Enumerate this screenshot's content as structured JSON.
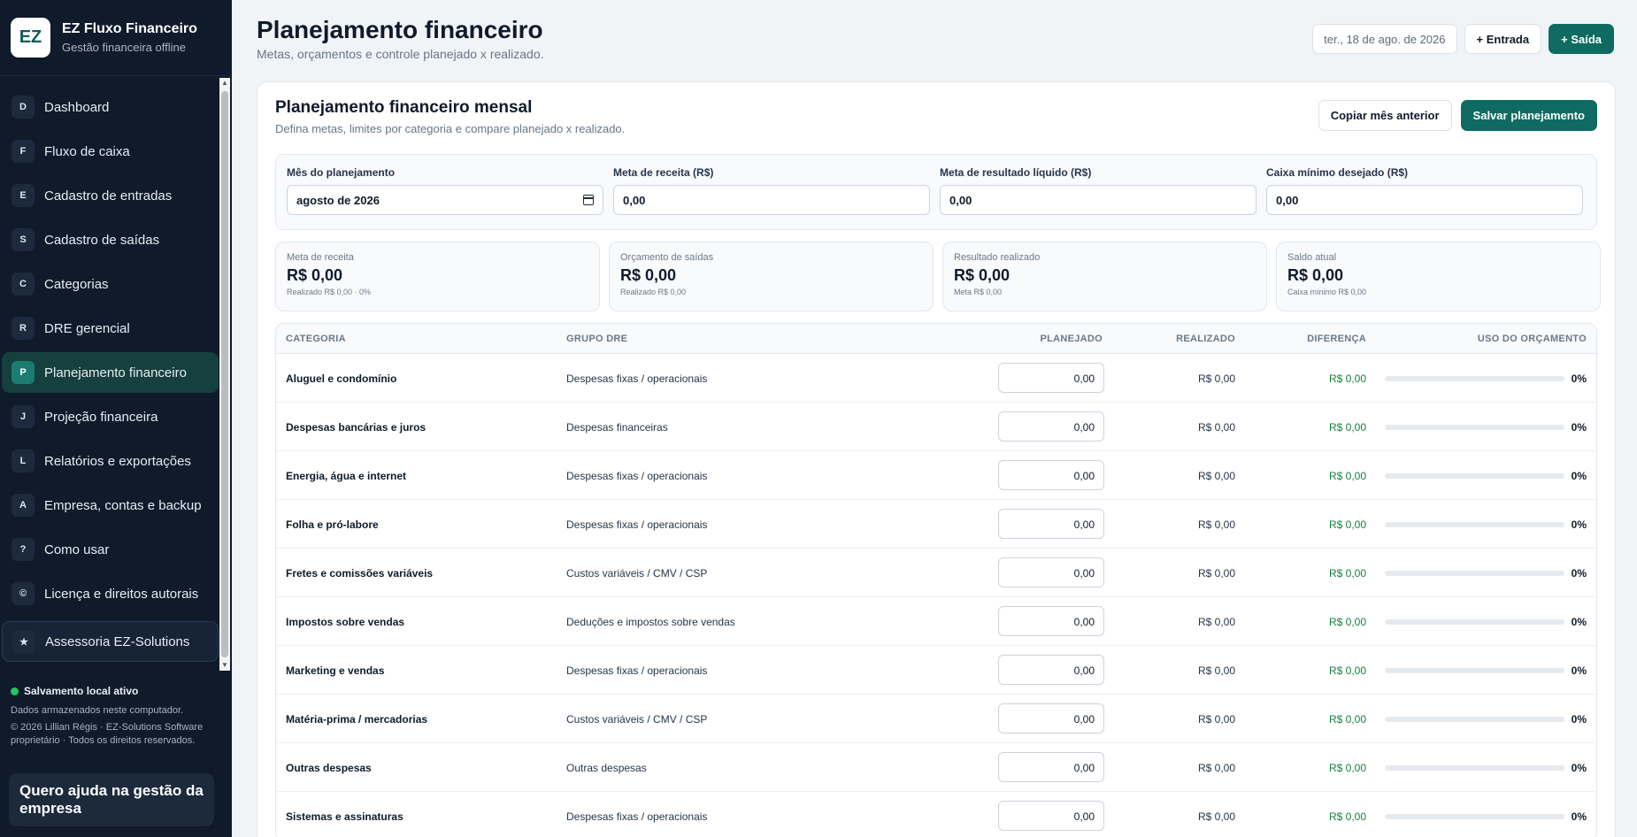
{
  "brand": {
    "logo": "EZ",
    "title": "EZ Fluxo Financeiro",
    "subtitle": "Gestão financeira offline"
  },
  "nav": [
    {
      "badge": "D",
      "label": "Dashboard"
    },
    {
      "badge": "F",
      "label": "Fluxo de caixa"
    },
    {
      "badge": "E",
      "label": "Cadastro de entradas"
    },
    {
      "badge": "S",
      "label": "Cadastro de saídas"
    },
    {
      "badge": "C",
      "label": "Categorias"
    },
    {
      "badge": "R",
      "label": "DRE gerencial"
    },
    {
      "badge": "P",
      "label": "Planejamento financeiro",
      "active": true
    },
    {
      "badge": "J",
      "label": "Projeção financeira"
    },
    {
      "badge": "L",
      "label": "Relatórios e exportações"
    },
    {
      "badge": "A",
      "label": "Empresa, contas e backup"
    },
    {
      "badge": "?",
      "label": "Como usar"
    },
    {
      "badge": "©",
      "label": "Licença e direitos autorais"
    },
    {
      "badge": "★",
      "label": "Assessoria EZ-Solutions",
      "boxed": true
    }
  ],
  "sidebar_footer": {
    "status": "Salvamento local ativo",
    "storage_note": "Dados armazenados neste computador.",
    "copyright": "© 2026 Lillian Régis · EZ-Solutions Software proprietário · Todos os direitos reservados.",
    "help_cta": "Quero ajuda na gestão da empresa",
    "status_color": "#22c55e"
  },
  "header": {
    "title": "Planejamento financeiro",
    "subtitle": "Metas, orçamentos e controle planejado x realizado.",
    "date": "ter., 18 de ago. de 2026",
    "entrada_label": "+ Entrada",
    "saida_label": "+ Saída"
  },
  "card": {
    "title": "Planejamento financeiro mensal",
    "subtitle": "Defina metas, limites por categoria e compare planejado x realizado.",
    "copy_label": "Copiar mês anterior",
    "save_label": "Salvar planejamento"
  },
  "form": {
    "month_label": "Mês do planejamento",
    "month_value": "agosto de 2026",
    "revenue_label": "Meta de receita (R$)",
    "revenue_value": "0,00",
    "net_label": "Meta de resultado líquido (R$)",
    "net_value": "0,00",
    "cash_label": "Caixa mínimo desejado (R$)",
    "cash_value": "0,00"
  },
  "kpis": [
    {
      "label": "Meta de receita",
      "value": "R$ 0,00",
      "note": "Realizado R$ 0,00 · 0%"
    },
    {
      "label": "Orçamento de saídas",
      "value": "R$ 0,00",
      "note": "Realizado R$ 0,00"
    },
    {
      "label": "Resultado realizado",
      "value": "R$ 0,00",
      "note": "Meta R$ 0,00"
    },
    {
      "label": "Saldo atual",
      "value": "R$ 0,00",
      "note": "Caixa mínimo R$ 0,00"
    }
  ],
  "table": {
    "headers": [
      "CATEGORIA",
      "GRUPO DRE",
      "PLANEJADO",
      "REALIZADO",
      "DIFERENÇA",
      "USO DO ORÇAMENTO"
    ],
    "rows": [
      {
        "category": "Aluguel e condomínio",
        "group": "Despesas fixas / operacionais",
        "planned": "0,00",
        "realized": "R$ 0,00",
        "diff": "R$ 0,00",
        "usage": 0,
        "usage_label": "0%"
      },
      {
        "category": "Despesas bancárias e juros",
        "group": "Despesas financeiras",
        "planned": "0,00",
        "realized": "R$ 0,00",
        "diff": "R$ 0,00",
        "usage": 0,
        "usage_label": "0%"
      },
      {
        "category": "Energia, água e internet",
        "group": "Despesas fixas / operacionais",
        "planned": "0,00",
        "realized": "R$ 0,00",
        "diff": "R$ 0,00",
        "usage": 0,
        "usage_label": "0%"
      },
      {
        "category": "Folha e pró-labore",
        "group": "Despesas fixas / operacionais",
        "planned": "0,00",
        "realized": "R$ 0,00",
        "diff": "R$ 0,00",
        "usage": 0,
        "usage_label": "0%"
      },
      {
        "category": "Fretes e comissões variáveis",
        "group": "Custos variáveis / CMV / CSP",
        "planned": "0,00",
        "realized": "R$ 0,00",
        "diff": "R$ 0,00",
        "usage": 0,
        "usage_label": "0%"
      },
      {
        "category": "Impostos sobre vendas",
        "group": "Deduções e impostos sobre vendas",
        "planned": "0,00",
        "realized": "R$ 0,00",
        "diff": "R$ 0,00",
        "usage": 0,
        "usage_label": "0%"
      },
      {
        "category": "Marketing e vendas",
        "group": "Despesas fixas / operacionais",
        "planned": "0,00",
        "realized": "R$ 0,00",
        "diff": "R$ 0,00",
        "usage": 0,
        "usage_label": "0%"
      },
      {
        "category": "Matéria-prima / mercadorias",
        "group": "Custos variáveis / CMV / CSP",
        "planned": "0,00",
        "realized": "R$ 0,00",
        "diff": "R$ 0,00",
        "usage": 0,
        "usage_label": "0%"
      },
      {
        "category": "Outras despesas",
        "group": "Outras despesas",
        "planned": "0,00",
        "realized": "R$ 0,00",
        "diff": "R$ 0,00",
        "usage": 0,
        "usage_label": "0%"
      },
      {
        "category": "Sistemas e assinaturas",
        "group": "Despesas fixas / operacionais",
        "planned": "0,00",
        "realized": "R$ 0,00",
        "diff": "R$ 0,00",
        "usage": 0,
        "usage_label": "0%"
      }
    ]
  },
  "colors": {
    "accent": "#0f6b62",
    "sidebar_bg": "#0f1a2b",
    "positive": "#15803d"
  }
}
